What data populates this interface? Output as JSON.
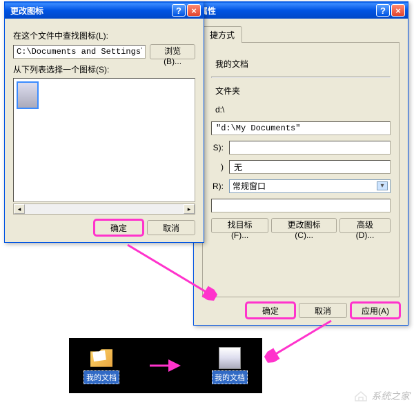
{
  "change_icon_dialog": {
    "title": "更改图标",
    "search_label": "在这个文件中查找图标(L):",
    "path_value": "C:\\Documents and Settings\\Admi",
    "browse_btn": "浏览(B)...",
    "select_label": "从下列表选择一个图标(S):",
    "ok_btn": "确定",
    "cancel_btn": "取消"
  },
  "properties_dialog": {
    "title": "属性",
    "tab_shortcut": "捷方式",
    "name_value": "我的文档",
    "type_label": "",
    "type_value": "文件夹",
    "location_label": "",
    "location_value": "d:\\",
    "target_value": "\"d:\\My Documents\"",
    "start_in_label": "S):",
    "start_in_value": "",
    "shortcut_key_label": ")",
    "shortcut_key_value": "无",
    "run_label": "R):",
    "run_value": "常规窗口",
    "comment_value": "",
    "find_target_btn": "找目标(F)...",
    "change_icon_btn": "更改图标(C)...",
    "advanced_btn": "高级(D)...",
    "ok_btn": "确定",
    "cancel_btn": "取消",
    "apply_btn": "应用(A)"
  },
  "desktop": {
    "icon1_label": "我的文档",
    "icon2_label": "我的文档"
  },
  "watermark": "系统之家"
}
